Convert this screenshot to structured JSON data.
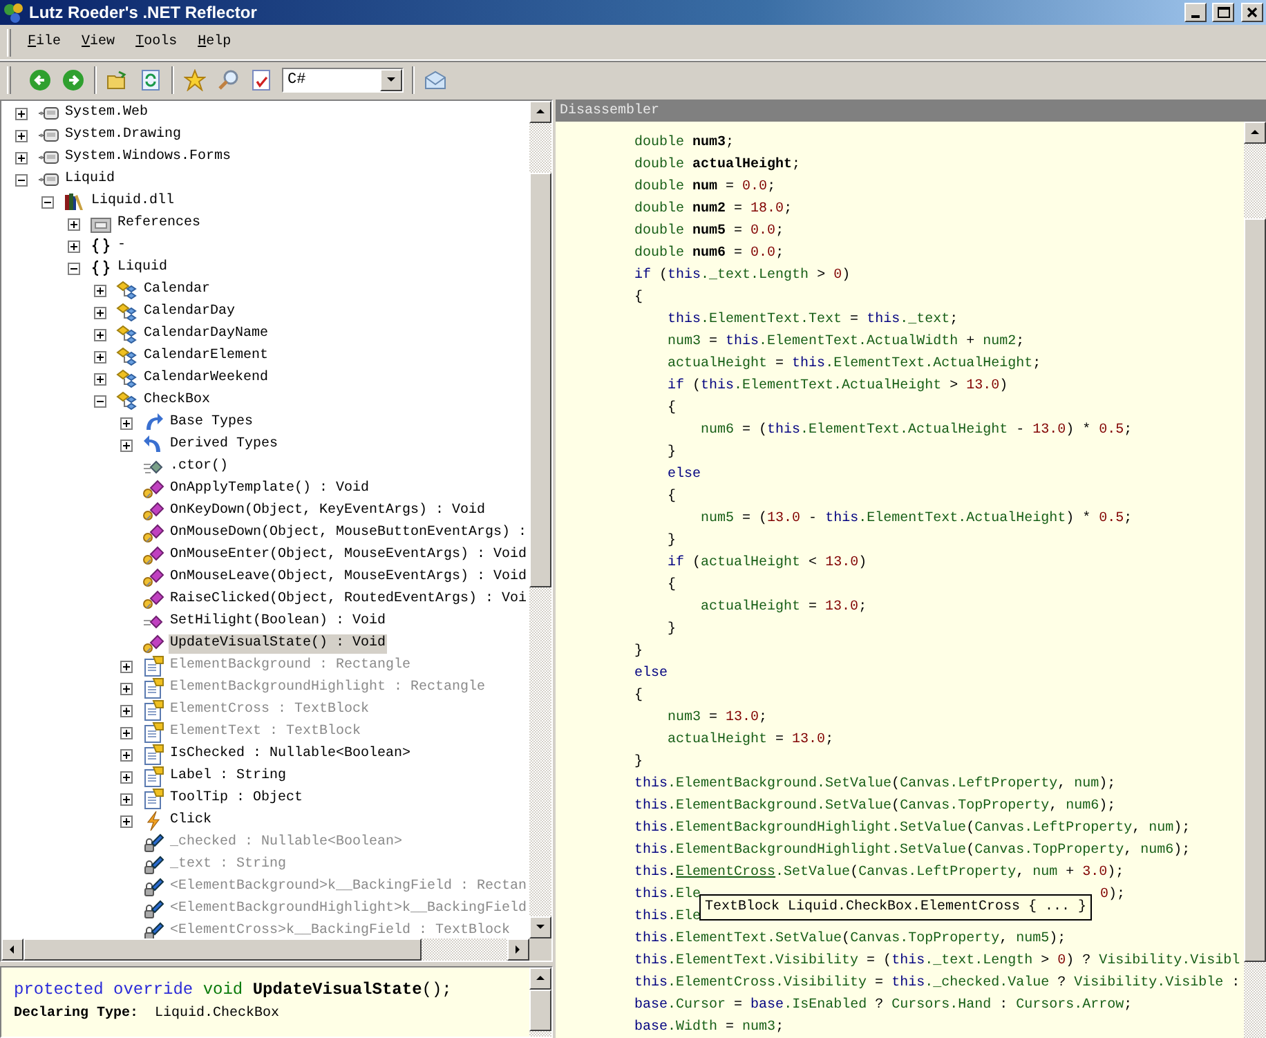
{
  "window": {
    "title": "Lutz Roeder's .NET Reflector"
  },
  "menu": [
    "File",
    "View",
    "Tools",
    "Help"
  ],
  "toolbar": {
    "language": "C#"
  },
  "tree": [
    {
      "label": "System.Web",
      "kind": "assembly",
      "expanded": false,
      "dimmed": false,
      "selected": false
    },
    {
      "label": "System.Drawing",
      "kind": "assembly",
      "expanded": false,
      "dimmed": false,
      "selected": false
    },
    {
      "label": "System.Windows.Forms",
      "kind": "assembly",
      "expanded": false,
      "dimmed": false,
      "selected": false
    },
    {
      "label": "Liquid",
      "kind": "assembly",
      "expanded": true,
      "dimmed": false,
      "selected": false,
      "children": [
        {
          "label": "Liquid.dll",
          "kind": "library",
          "expanded": true,
          "dimmed": false,
          "selected": false,
          "children": [
            {
              "label": "References",
              "kind": "references",
              "expanded": false,
              "dimmed": false,
              "selected": false
            },
            {
              "label": "-",
              "kind": "namespace",
              "expanded": false,
              "dimmed": false,
              "selected": false
            },
            {
              "label": "Liquid",
              "kind": "namespace",
              "expanded": true,
              "dimmed": false,
              "selected": false,
              "children": [
                {
                  "label": "Calendar",
                  "kind": "class",
                  "expanded": false,
                  "dimmed": false,
                  "selected": false
                },
                {
                  "label": "CalendarDay",
                  "kind": "class",
                  "expanded": false,
                  "dimmed": false,
                  "selected": false
                },
                {
                  "label": "CalendarDayName",
                  "kind": "class",
                  "expanded": false,
                  "dimmed": false,
                  "selected": false
                },
                {
                  "label": "CalendarElement",
                  "kind": "class",
                  "expanded": false,
                  "dimmed": false,
                  "selected": false
                },
                {
                  "label": "CalendarWeekend",
                  "kind": "class",
                  "expanded": false,
                  "dimmed": false,
                  "selected": false
                },
                {
                  "label": "CheckBox",
                  "kind": "class",
                  "expanded": true,
                  "dimmed": false,
                  "selected": false,
                  "children": [
                    {
                      "label": "Base Types",
                      "kind": "basetypes",
                      "expanded": false,
                      "dimmed": false,
                      "selected": false
                    },
                    {
                      "label": "Derived Types",
                      "kind": "derivedtypes",
                      "expanded": false,
                      "dimmed": false,
                      "selected": false
                    },
                    {
                      "label": ".ctor()",
                      "kind": "ctor",
                      "dimmed": false,
                      "selected": false
                    },
                    {
                      "label": "OnApplyTemplate() : Void",
                      "kind": "method",
                      "dimmed": false,
                      "selected": false
                    },
                    {
                      "label": "OnKeyDown(Object, KeyEventArgs) : Void",
                      "kind": "method",
                      "dimmed": false,
                      "selected": false
                    },
                    {
                      "label": "OnMouseDown(Object, MouseButtonEventArgs) :",
                      "kind": "method",
                      "dimmed": false,
                      "selected": false
                    },
                    {
                      "label": "OnMouseEnter(Object, MouseEventArgs) : Void",
                      "kind": "method",
                      "dimmed": false,
                      "selected": false
                    },
                    {
                      "label": "OnMouseLeave(Object, MouseEventArgs) : Void",
                      "kind": "method",
                      "dimmed": false,
                      "selected": false
                    },
                    {
                      "label": "RaiseClicked(Object, RoutedEventArgs) : Voi",
                      "kind": "method",
                      "dimmed": false,
                      "selected": false
                    },
                    {
                      "label": "SetHilight(Boolean) : Void",
                      "kind": "private-method",
                      "dimmed": false,
                      "selected": false
                    },
                    {
                      "label": "UpdateVisualState() : Void",
                      "kind": "method",
                      "dimmed": false,
                      "selected": true
                    },
                    {
                      "label": "ElementBackground : Rectangle",
                      "kind": "property",
                      "expanded": false,
                      "dimmed": true,
                      "selected": false
                    },
                    {
                      "label": "ElementBackgroundHighlight : Rectangle",
                      "kind": "property",
                      "expanded": false,
                      "dimmed": true,
                      "selected": false
                    },
                    {
                      "label": "ElementCross : TextBlock",
                      "kind": "property",
                      "expanded": false,
                      "dimmed": true,
                      "selected": false
                    },
                    {
                      "label": "ElementText : TextBlock",
                      "kind": "property",
                      "expanded": false,
                      "dimmed": true,
                      "selected": false
                    },
                    {
                      "label": "IsChecked : Nullable<Boolean>",
                      "kind": "property",
                      "expanded": false,
                      "dimmed": false,
                      "selected": false
                    },
                    {
                      "label": "Label : String",
                      "kind": "property",
                      "expanded": false,
                      "dimmed": false,
                      "selected": false
                    },
                    {
                      "label": "ToolTip : Object",
                      "kind": "property",
                      "expanded": false,
                      "dimmed": false,
                      "selected": false
                    },
                    {
                      "label": "Click",
                      "kind": "event",
                      "expanded": false,
                      "dimmed": false,
                      "selected": false
                    },
                    {
                      "label": "_checked : Nullable<Boolean>",
                      "kind": "field",
                      "dimmed": true,
                      "selected": false
                    },
                    {
                      "label": "_text : String",
                      "kind": "field",
                      "dimmed": true,
                      "selected": false
                    },
                    {
                      "label": "<ElementBackground>k__BackingField : Rectan",
                      "kind": "field",
                      "dimmed": true,
                      "selected": false
                    },
                    {
                      "label": "<ElementBackgroundHighlight>k__BackingField",
                      "kind": "field",
                      "dimmed": true,
                      "selected": false
                    },
                    {
                      "label": "<ElementCross>k__BackingField : TextBlock",
                      "kind": "field",
                      "dimmed": true,
                      "selected": false
                    }
                  ]
                }
              ]
            }
          ]
        }
      ]
    }
  ],
  "info": {
    "signature": [
      {
        "kind": "kw",
        "text": "protected override "
      },
      {
        "kind": "type",
        "text": "void "
      },
      {
        "kind": "decl",
        "text": "UpdateVisualState"
      },
      {
        "kind": "p",
        "text": "();"
      }
    ],
    "declaring_label": "Declaring Type:",
    "declaring_value": "Liquid.CheckBox"
  },
  "disassembler": {
    "title": "Disassembler",
    "tooltip": "TextBlock Liquid.CheckBox.ElementCross { ... }",
    "lines": [
      {
        "tokens": [
          {
            "kind": "id",
            "text": "    double "
          },
          {
            "kind": "decl",
            "text": "num3"
          },
          {
            "kind": "p",
            "text": ";"
          }
        ]
      },
      {
        "tokens": [
          {
            "kind": "id",
            "text": "    double "
          },
          {
            "kind": "decl",
            "text": "actualHeight"
          },
          {
            "kind": "p",
            "text": ";"
          }
        ]
      },
      {
        "tokens": [
          {
            "kind": "id",
            "text": "    double "
          },
          {
            "kind": "decl",
            "text": "num"
          },
          {
            "kind": "p",
            "text": " = "
          },
          {
            "kind": "num",
            "text": "0.0"
          },
          {
            "kind": "p",
            "text": ";"
          }
        ]
      },
      {
        "tokens": [
          {
            "kind": "id",
            "text": "    double "
          },
          {
            "kind": "decl",
            "text": "num2"
          },
          {
            "kind": "p",
            "text": " = "
          },
          {
            "kind": "num",
            "text": "18.0"
          },
          {
            "kind": "p",
            "text": ";"
          }
        ]
      },
      {
        "tokens": [
          {
            "kind": "id",
            "text": "    double "
          },
          {
            "kind": "decl",
            "text": "num5"
          },
          {
            "kind": "p",
            "text": " = "
          },
          {
            "kind": "num",
            "text": "0.0"
          },
          {
            "kind": "p",
            "text": ";"
          }
        ]
      },
      {
        "tokens": [
          {
            "kind": "id",
            "text": "    double "
          },
          {
            "kind": "decl",
            "text": "num6"
          },
          {
            "kind": "p",
            "text": " = "
          },
          {
            "kind": "num",
            "text": "0.0"
          },
          {
            "kind": "p",
            "text": ";"
          }
        ]
      },
      {
        "tokens": [
          {
            "kind": "kw",
            "text": "    if "
          },
          {
            "kind": "p",
            "text": "("
          },
          {
            "kind": "kw",
            "text": "this"
          },
          {
            "kind": "id",
            "text": "._text.Length"
          },
          {
            "kind": "p",
            "text": " > "
          },
          {
            "kind": "num",
            "text": "0"
          },
          {
            "kind": "p",
            "text": ")"
          }
        ]
      },
      {
        "tokens": [
          {
            "kind": "p",
            "text": "    {"
          }
        ]
      },
      {
        "tokens": [
          {
            "kind": "kw",
            "text": "        this"
          },
          {
            "kind": "id",
            "text": ".ElementText.Text"
          },
          {
            "kind": "p",
            "text": " = "
          },
          {
            "kind": "kw",
            "text": "this"
          },
          {
            "kind": "id",
            "text": "._text"
          },
          {
            "kind": "p",
            "text": ";"
          }
        ]
      },
      {
        "tokens": [
          {
            "kind": "id",
            "text": "        num3"
          },
          {
            "kind": "p",
            "text": " = "
          },
          {
            "kind": "kw",
            "text": "this"
          },
          {
            "kind": "id",
            "text": ".ElementText.ActualWidth"
          },
          {
            "kind": "p",
            "text": " + "
          },
          {
            "kind": "id",
            "text": "num2"
          },
          {
            "kind": "p",
            "text": ";"
          }
        ]
      },
      {
        "tokens": [
          {
            "kind": "id",
            "text": "        actualHeight"
          },
          {
            "kind": "p",
            "text": " = "
          },
          {
            "kind": "kw",
            "text": "this"
          },
          {
            "kind": "id",
            "text": ".ElementText.ActualHeight"
          },
          {
            "kind": "p",
            "text": ";"
          }
        ]
      },
      {
        "tokens": [
          {
            "kind": "kw",
            "text": "        if "
          },
          {
            "kind": "p",
            "text": "("
          },
          {
            "kind": "kw",
            "text": "this"
          },
          {
            "kind": "id",
            "text": ".ElementText.ActualHeight"
          },
          {
            "kind": "p",
            "text": " > "
          },
          {
            "kind": "num",
            "text": "13.0"
          },
          {
            "kind": "p",
            "text": ")"
          }
        ]
      },
      {
        "tokens": [
          {
            "kind": "p",
            "text": "        {"
          }
        ]
      },
      {
        "tokens": [
          {
            "kind": "id",
            "text": "            num6"
          },
          {
            "kind": "p",
            "text": " = ("
          },
          {
            "kind": "kw",
            "text": "this"
          },
          {
            "kind": "id",
            "text": ".ElementText.ActualHeight"
          },
          {
            "kind": "p",
            "text": " - "
          },
          {
            "kind": "num",
            "text": "13.0"
          },
          {
            "kind": "p",
            "text": ") * "
          },
          {
            "kind": "num",
            "text": "0.5"
          },
          {
            "kind": "p",
            "text": ";"
          }
        ]
      },
      {
        "tokens": [
          {
            "kind": "p",
            "text": "        }"
          }
        ]
      },
      {
        "tokens": [
          {
            "kind": "kw",
            "text": "        else"
          }
        ]
      },
      {
        "tokens": [
          {
            "kind": "p",
            "text": "        {"
          }
        ]
      },
      {
        "tokens": [
          {
            "kind": "id",
            "text": "            num5"
          },
          {
            "kind": "p",
            "text": " = ("
          },
          {
            "kind": "num",
            "text": "13.0"
          },
          {
            "kind": "p",
            "text": " - "
          },
          {
            "kind": "kw",
            "text": "this"
          },
          {
            "kind": "id",
            "text": ".ElementText.ActualHeight"
          },
          {
            "kind": "p",
            "text": ") * "
          },
          {
            "kind": "num",
            "text": "0.5"
          },
          {
            "kind": "p",
            "text": ";"
          }
        ]
      },
      {
        "tokens": [
          {
            "kind": "p",
            "text": "        }"
          }
        ]
      },
      {
        "tokens": [
          {
            "kind": "kw",
            "text": "        if "
          },
          {
            "kind": "p",
            "text": "("
          },
          {
            "kind": "id",
            "text": "actualHeight"
          },
          {
            "kind": "p",
            "text": " < "
          },
          {
            "kind": "num",
            "text": "13.0"
          },
          {
            "kind": "p",
            "text": ")"
          }
        ]
      },
      {
        "tokens": [
          {
            "kind": "p",
            "text": "        {"
          }
        ]
      },
      {
        "tokens": [
          {
            "kind": "id",
            "text": "            actualHeight"
          },
          {
            "kind": "p",
            "text": " = "
          },
          {
            "kind": "num",
            "text": "13.0"
          },
          {
            "kind": "p",
            "text": ";"
          }
        ]
      },
      {
        "tokens": [
          {
            "kind": "p",
            "text": "        }"
          }
        ]
      },
      {
        "tokens": [
          {
            "kind": "p",
            "text": "    }"
          }
        ]
      },
      {
        "tokens": [
          {
            "kind": "kw",
            "text": "    else"
          }
        ]
      },
      {
        "tokens": [
          {
            "kind": "p",
            "text": "    {"
          }
        ]
      },
      {
        "tokens": [
          {
            "kind": "id",
            "text": "        num3"
          },
          {
            "kind": "p",
            "text": " = "
          },
          {
            "kind": "num",
            "text": "13.0"
          },
          {
            "kind": "p",
            "text": ";"
          }
        ]
      },
      {
        "tokens": [
          {
            "kind": "id",
            "text": "        actualHeight"
          },
          {
            "kind": "p",
            "text": " = "
          },
          {
            "kind": "num",
            "text": "13.0"
          },
          {
            "kind": "p",
            "text": ";"
          }
        ]
      },
      {
        "tokens": [
          {
            "kind": "p",
            "text": "    }"
          }
        ]
      },
      {
        "tokens": [
          {
            "kind": "kw",
            "text": "    this"
          },
          {
            "kind": "id",
            "text": ".ElementBackground.SetValue"
          },
          {
            "kind": "p",
            "text": "("
          },
          {
            "kind": "id",
            "text": "Canvas.LeftProperty"
          },
          {
            "kind": "p",
            "text": ", "
          },
          {
            "kind": "id",
            "text": "num"
          },
          {
            "kind": "p",
            "text": ");"
          }
        ]
      },
      {
        "tokens": [
          {
            "kind": "kw",
            "text": "    this"
          },
          {
            "kind": "id",
            "text": ".ElementBackground.SetValue"
          },
          {
            "kind": "p",
            "text": "("
          },
          {
            "kind": "id",
            "text": "Canvas.TopProperty"
          },
          {
            "kind": "p",
            "text": ", "
          },
          {
            "kind": "id",
            "text": "num6"
          },
          {
            "kind": "p",
            "text": ");"
          }
        ]
      },
      {
        "tokens": [
          {
            "kind": "kw",
            "text": "    this"
          },
          {
            "kind": "id",
            "text": ".ElementBackgroundHighlight.SetValue"
          },
          {
            "kind": "p",
            "text": "("
          },
          {
            "kind": "id",
            "text": "Canvas.LeftProperty"
          },
          {
            "kind": "p",
            "text": ", "
          },
          {
            "kind": "id",
            "text": "num"
          },
          {
            "kind": "p",
            "text": ");"
          }
        ]
      },
      {
        "tokens": [
          {
            "kind": "kw",
            "text": "    this"
          },
          {
            "kind": "id",
            "text": ".ElementBackgroundHighlight.SetValue"
          },
          {
            "kind": "p",
            "text": "("
          },
          {
            "kind": "id",
            "text": "Canvas.TopProperty"
          },
          {
            "kind": "p",
            "text": ", "
          },
          {
            "kind": "id",
            "text": "num6"
          },
          {
            "kind": "p",
            "text": ");"
          }
        ]
      },
      {
        "tokens": [
          {
            "kind": "kw",
            "text": "    this"
          },
          {
            "kind": "p",
            "text": "."
          },
          {
            "kind": "link",
            "text": "ElementCross"
          },
          {
            "kind": "id",
            "text": ".SetValue"
          },
          {
            "kind": "p",
            "text": "("
          },
          {
            "kind": "id",
            "text": "Canvas.LeftProperty"
          },
          {
            "kind": "p",
            "text": ", "
          },
          {
            "kind": "id",
            "text": "num"
          },
          {
            "kind": "p",
            "text": " + "
          },
          {
            "kind": "num",
            "text": "3.0"
          },
          {
            "kind": "p",
            "text": ");"
          }
        ]
      },
      {
        "tokens": [
          {
            "kind": "kw",
            "text": "    this"
          },
          {
            "kind": "id",
            "text": ".Ele"
          },
          {
            "kind": "gap"
          },
          {
            "kind": "num",
            "text": "0"
          },
          {
            "kind": "p",
            "text": ");"
          }
        ]
      },
      {
        "tokens": [
          {
            "kind": "kw",
            "text": "    this"
          },
          {
            "kind": "id",
            "text": ".Ele"
          }
        ]
      },
      {
        "tokens": [
          {
            "kind": "kw",
            "text": "    this"
          },
          {
            "kind": "id",
            "text": ".ElementText.SetValue"
          },
          {
            "kind": "p",
            "text": "("
          },
          {
            "kind": "id",
            "text": "Canvas.TopProperty"
          },
          {
            "kind": "p",
            "text": ", "
          },
          {
            "kind": "id",
            "text": "num5"
          },
          {
            "kind": "p",
            "text": ");"
          }
        ]
      },
      {
        "tokens": [
          {
            "kind": "kw",
            "text": "    this"
          },
          {
            "kind": "id",
            "text": ".ElementText.Visibility"
          },
          {
            "kind": "p",
            "text": " = ("
          },
          {
            "kind": "kw",
            "text": "this"
          },
          {
            "kind": "id",
            "text": "._text.Length"
          },
          {
            "kind": "p",
            "text": " > "
          },
          {
            "kind": "num",
            "text": "0"
          },
          {
            "kind": "p",
            "text": ") ? "
          },
          {
            "kind": "id",
            "text": "Visibility.Visibl"
          }
        ]
      },
      {
        "tokens": [
          {
            "kind": "kw",
            "text": "    this"
          },
          {
            "kind": "id",
            "text": ".ElementCross.Visibility"
          },
          {
            "kind": "p",
            "text": " = "
          },
          {
            "kind": "kw",
            "text": "this"
          },
          {
            "kind": "id",
            "text": "._checked.Value"
          },
          {
            "kind": "p",
            "text": " ? "
          },
          {
            "kind": "id",
            "text": "Visibility.Visible"
          },
          {
            "kind": "p",
            "text": " :"
          }
        ]
      },
      {
        "tokens": [
          {
            "kind": "kw",
            "text": "    base"
          },
          {
            "kind": "id",
            "text": ".Cursor"
          },
          {
            "kind": "p",
            "text": " = "
          },
          {
            "kind": "kw",
            "text": "base"
          },
          {
            "kind": "id",
            "text": ".IsEnabled"
          },
          {
            "kind": "p",
            "text": " ? "
          },
          {
            "kind": "id",
            "text": "Cursors.Hand"
          },
          {
            "kind": "p",
            "text": " : "
          },
          {
            "kind": "id",
            "text": "Cursors.Arrow"
          },
          {
            "kind": "p",
            "text": ";"
          }
        ]
      },
      {
        "tokens": [
          {
            "kind": "kw",
            "text": "    base"
          },
          {
            "kind": "id",
            "text": ".Width"
          },
          {
            "kind": "p",
            "text": " = "
          },
          {
            "kind": "id",
            "text": "num3"
          },
          {
            "kind": "p",
            "text": ";"
          }
        ]
      }
    ]
  }
}
